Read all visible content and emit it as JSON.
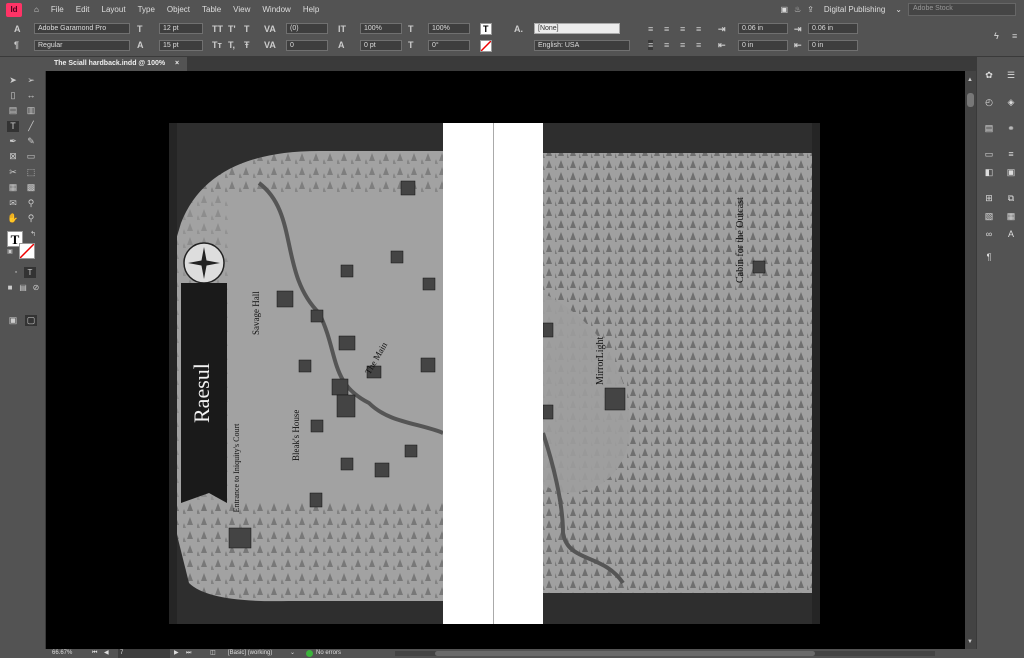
{
  "app": {
    "logo_text": "Id",
    "menu": [
      "File",
      "Edit",
      "Layout",
      "Type",
      "Object",
      "Table",
      "View",
      "Window",
      "Help"
    ],
    "workspace": "Digital Publishing",
    "stock_placeholder": "Adobe Stock"
  },
  "control": {
    "font_family": "Adobe Garamond Pro",
    "font_style": "Regular",
    "size": "12 pt",
    "leading": "15 pt",
    "kerning": "(0)",
    "tracking": "0",
    "vscale": "100%",
    "hscale": "100%",
    "baseline": "0 pt",
    "skew": "0°",
    "char_style": "[None]",
    "language": "English: USA",
    "indent_left": "0.06 in",
    "indent_right": "0.06 in",
    "space_before": "0 in",
    "space_after": "0 in"
  },
  "document": {
    "tab_title": "The Sciall hardback.indd @ 100%",
    "map": {
      "title": "Raesul",
      "labels": {
        "savage_hall": "Savage Hall",
        "the_main": "The Main",
        "bleaks_house": "Bleak's House",
        "entrance": "Entrance to Iniquity's Court",
        "mirrorlight": "MirrorLight",
        "cabin": "Cabin for the Outcast"
      }
    }
  },
  "status": {
    "zoom": "66.67%",
    "page": "7",
    "preflight_profile": "[Basic] (working)",
    "errors": "No errors",
    "ok_color": "#3cb43c"
  }
}
